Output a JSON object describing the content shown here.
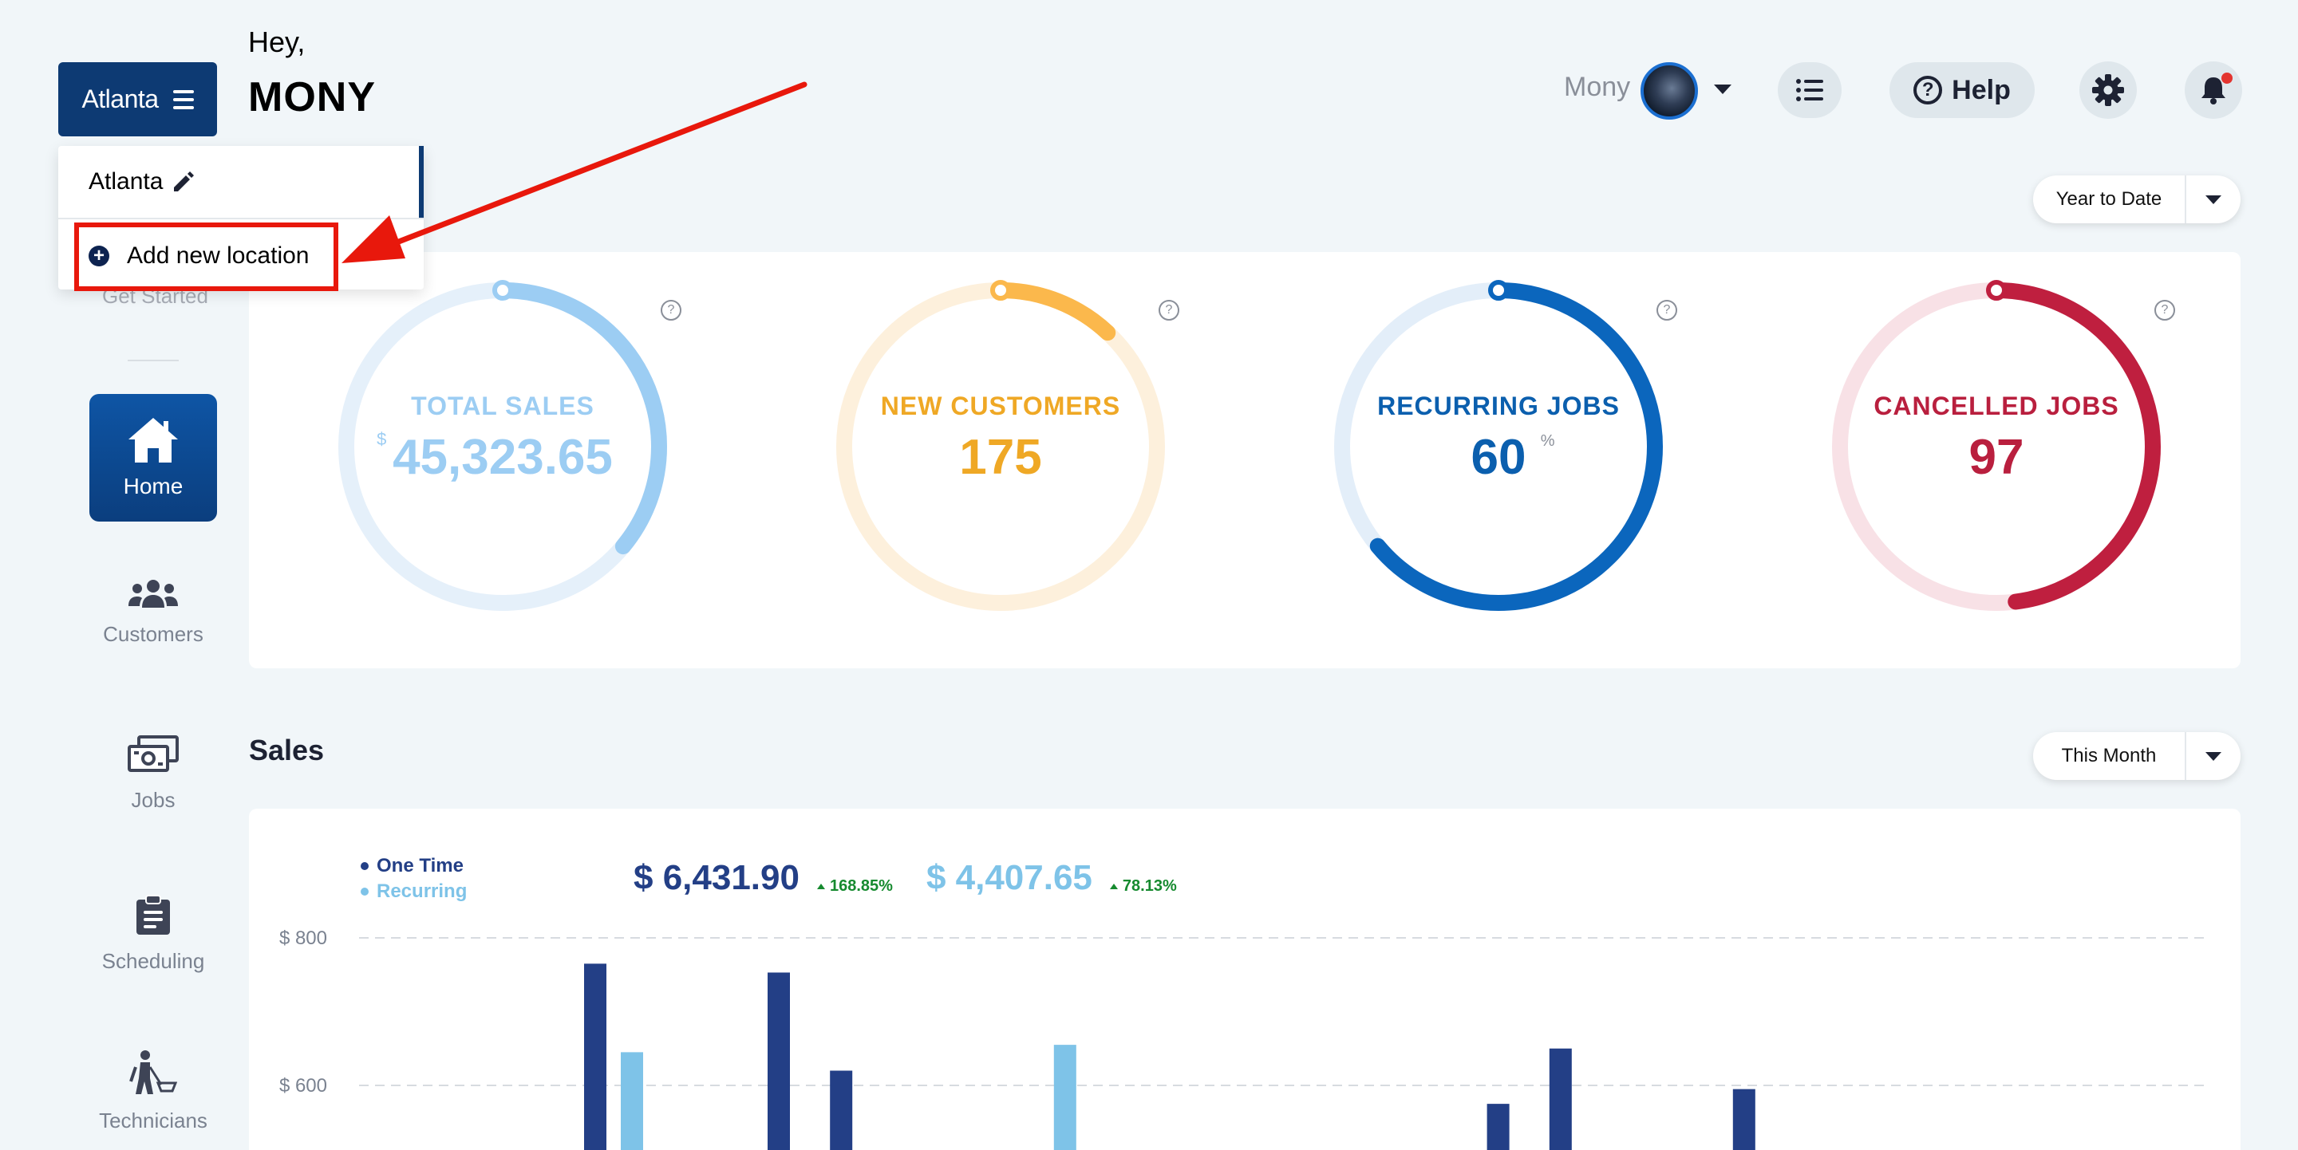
{
  "header": {
    "location_button": "Atlanta",
    "greeting_prefix": "Hey,",
    "greeting_name": "MONY",
    "user_name": "Mony",
    "help_label": "Help",
    "help_glyph": "?"
  },
  "location_menu": {
    "current": "Atlanta",
    "add_label": "Add new location",
    "add_glyph": "+"
  },
  "sidebar": {
    "get_started": "Get Started",
    "items": [
      {
        "label": "Home",
        "icon": "home-icon",
        "active": true
      },
      {
        "label": "Customers",
        "icon": "customers-icon"
      },
      {
        "label": "Jobs",
        "icon": "jobs-icon"
      },
      {
        "label": "Scheduling",
        "icon": "clipboard-icon"
      },
      {
        "label": "Technicians",
        "icon": "technician-icon"
      }
    ]
  },
  "filters": {
    "stats_period": "Year to Date",
    "sales_period": "This Month"
  },
  "stats": [
    {
      "label": "TOTAL SALES",
      "prefix": "$",
      "value": "45,323.65",
      "suffix": "",
      "progress": 0.36,
      "color": "#9ccdf3",
      "track": "#e5f0fa",
      "text_color": "#9ccdf3"
    },
    {
      "label": "NEW CUSTOMERS",
      "prefix": "",
      "value": "175",
      "suffix": "",
      "progress": 0.12,
      "color": "#fbb84c",
      "track": "#fdf0dc",
      "text_color": "#efa825"
    },
    {
      "label": "RECURRING JOBS",
      "prefix": "",
      "value": "60",
      "suffix": "%",
      "progress": 0.64,
      "color": "#0b66bd",
      "track": "#e3eef9",
      "text_color": "#0b5fae"
    },
    {
      "label": "CANCELLED JOBS",
      "prefix": "",
      "value": "97",
      "suffix": "",
      "progress": 0.48,
      "color": "#bf1f3f",
      "track": "#f8e1e6",
      "text_color": "#b91f3e"
    }
  ],
  "help_tip": "?",
  "sales": {
    "title": "Sales",
    "legend_one_time": "One Time",
    "legend_recurring": "Recurring",
    "one_time_total": "$ 6,431.90",
    "one_time_change": "168.85%",
    "recurring_total": "$ 4,407.65",
    "recurring_change": "78.13%",
    "colors": {
      "one_time": "#233f86",
      "recurring": "#7ec3e8",
      "change_up": "#168a2f"
    }
  },
  "chart_data": {
    "type": "bar",
    "ytick_labels": [
      "$ 800",
      "$ 600"
    ],
    "yticks": [
      800,
      600
    ],
    "ylim_visible": [
      510,
      840
    ],
    "grid": true,
    "legend": "top-left",
    "series": [
      {
        "name": "One Time",
        "bars": [
          {
            "slot": 6.0,
            "value": 765
          },
          {
            "slot": 11.0,
            "value": 753
          },
          {
            "slot": 12.7,
            "value": 620
          },
          {
            "slot": 30.6,
            "value": 575
          },
          {
            "slot": 32.3,
            "value": 650
          },
          {
            "slot": 37.3,
            "value": 595
          }
        ]
      },
      {
        "name": "Recurring",
        "bars": [
          {
            "slot": 7.0,
            "value": 645
          },
          {
            "slot": 18.8,
            "value": 655
          }
        ]
      }
    ]
  }
}
